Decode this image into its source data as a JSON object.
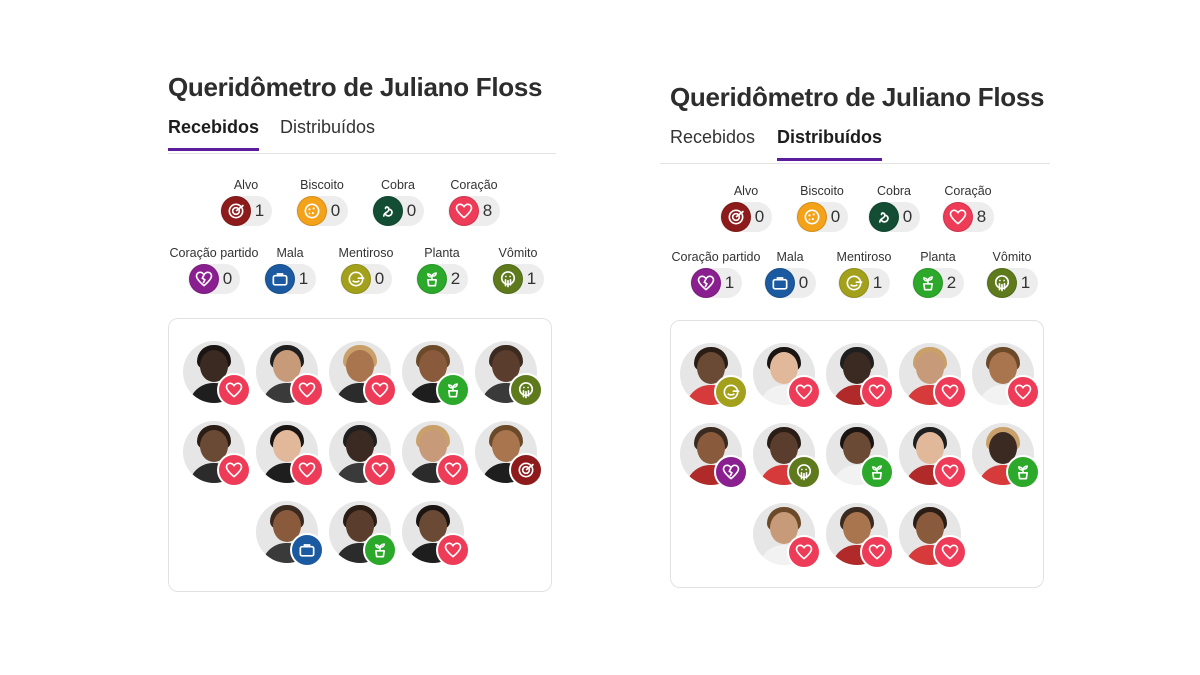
{
  "colors": {
    "alvo": "#8e1b1b",
    "biscoito": "#f3a21a",
    "cobra": "#134d34",
    "coracao": "#ee3b57",
    "coracao_partido": "#8a1f8f",
    "mala": "#1b5aa0",
    "mentiroso": "#a3a11c",
    "planta": "#2ca92a",
    "vomito": "#5e7a1d",
    "tab_accent": "#5b1d9c"
  },
  "panels": [
    {
      "title": "Queridômetro de Juliano Floss",
      "tabs": [
        {
          "label": "Recebidos"
        },
        {
          "label": "Distribuídos"
        }
      ],
      "active_tab": 0,
      "emojis": [
        {
          "label": "Alvo",
          "icon": "alvo",
          "count": "1"
        },
        {
          "label": "Biscoito",
          "icon": "biscoito",
          "count": "0"
        },
        {
          "label": "Cobra",
          "icon": "cobra",
          "count": "0"
        },
        {
          "label": "Coração",
          "icon": "coracao",
          "count": "8"
        },
        {
          "label": "Coração partido",
          "icon": "coracao_partido",
          "count": "0"
        },
        {
          "label": "Mala",
          "icon": "mala",
          "count": "1"
        },
        {
          "label": "Mentiroso",
          "icon": "mentiroso",
          "count": "0"
        },
        {
          "label": "Planta",
          "icon": "planta",
          "count": "2"
        },
        {
          "label": "Vômito",
          "icon": "vomito",
          "count": "1"
        }
      ],
      "participants": [
        {
          "badge": "coracao"
        },
        {
          "badge": "coracao"
        },
        {
          "badge": "coracao"
        },
        {
          "badge": "planta"
        },
        {
          "badge": "vomito"
        },
        {
          "badge": "coracao"
        },
        {
          "badge": "coracao"
        },
        {
          "badge": "coracao"
        },
        {
          "badge": "coracao"
        },
        {
          "badge": "alvo"
        },
        {
          "badge": "mala"
        },
        {
          "badge": "planta"
        },
        {
          "badge": "coracao"
        }
      ]
    },
    {
      "title": "Queridômetro de Juliano Floss",
      "tabs": [
        {
          "label": "Recebidos"
        },
        {
          "label": "Distribuídos"
        }
      ],
      "active_tab": 1,
      "emojis": [
        {
          "label": "Alvo",
          "icon": "alvo",
          "count": "0"
        },
        {
          "label": "Biscoito",
          "icon": "biscoito",
          "count": "0"
        },
        {
          "label": "Cobra",
          "icon": "cobra",
          "count": "0"
        },
        {
          "label": "Coração",
          "icon": "coracao",
          "count": "8"
        },
        {
          "label": "Coração partido",
          "icon": "coracao_partido",
          "count": "1"
        },
        {
          "label": "Mala",
          "icon": "mala",
          "count": "0"
        },
        {
          "label": "Mentiroso",
          "icon": "mentiroso",
          "count": "1"
        },
        {
          "label": "Planta",
          "icon": "planta",
          "count": "2"
        },
        {
          "label": "Vômito",
          "icon": "vomito",
          "count": "1"
        }
      ],
      "participants": [
        {
          "badge": "mentiroso"
        },
        {
          "badge": "coracao"
        },
        {
          "badge": "coracao"
        },
        {
          "badge": "coracao"
        },
        {
          "badge": "coracao"
        },
        {
          "badge": "coracao_partido"
        },
        {
          "badge": "vomito"
        },
        {
          "badge": "planta"
        },
        {
          "badge": "coracao"
        },
        {
          "badge": "planta"
        },
        {
          "badge": "coracao"
        },
        {
          "badge": "coracao"
        },
        {
          "badge": "coracao"
        }
      ]
    }
  ]
}
